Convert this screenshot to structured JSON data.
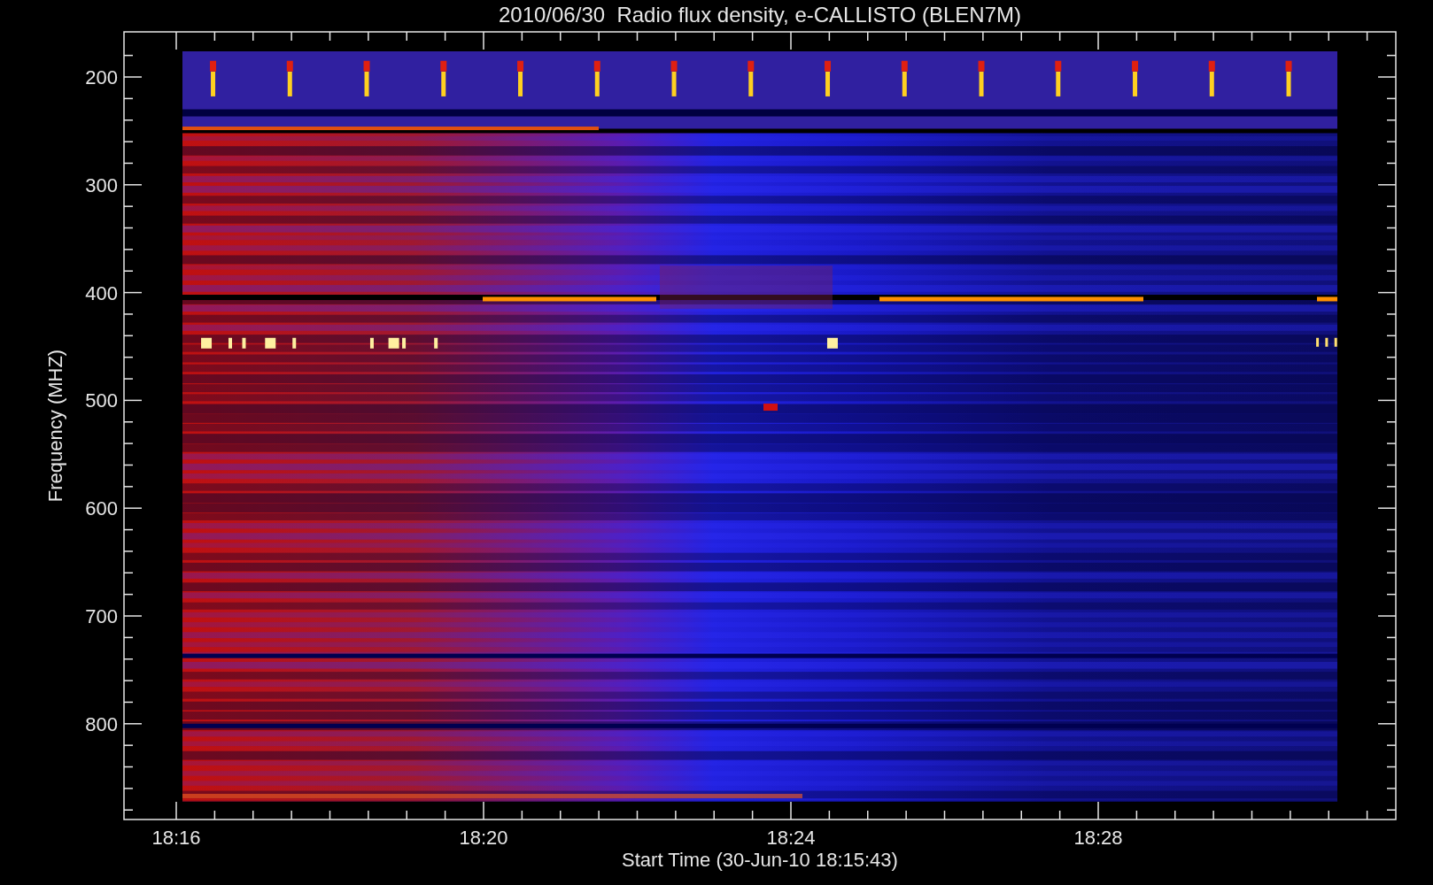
{
  "chart": {
    "title": "2010/06/30  Radio flux density, e-CALLISTO (BLEN7M)",
    "ylabel": "Frequency (MHZ)",
    "xlabel": "Start Time (30-Jun-10 18:15:43)",
    "yticks": [
      "200",
      "300",
      "400",
      "500",
      "600",
      "700",
      "800"
    ],
    "xticks": [
      "18:16",
      "18:20",
      "18:24",
      "18:28"
    ]
  }
}
